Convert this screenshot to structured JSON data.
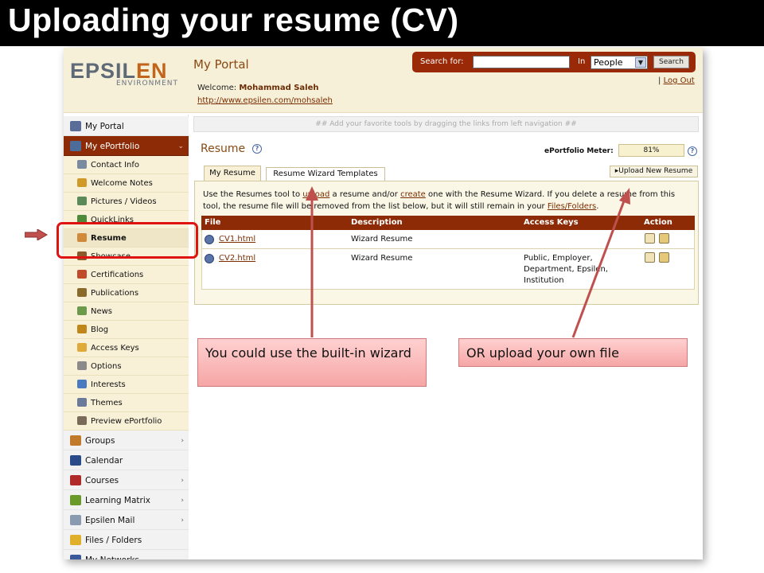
{
  "slide": {
    "title": "Uploading your resume (CV)"
  },
  "header": {
    "logo_main": "EPSIL",
    "logo_accent": "EN",
    "logo_sub": "ENVIRONMENT",
    "portal_title": "My Portal",
    "welcome_label": "Welcome:",
    "user_name": "Mohammad Saleh",
    "user_url": "http://www.epsilen.com/mohsaleh",
    "logout": "Log Out"
  },
  "search": {
    "label": "Search for:",
    "value": "",
    "in_label": "In",
    "scope": "People",
    "button": "Search"
  },
  "toolbar_hint": "## Add your favorite tools by dragging the links from left navigation ##",
  "sidebar": {
    "top_items": [
      {
        "label": "My Portal",
        "color": "#5a6d99"
      },
      {
        "label": "My ePortfolio",
        "color": "#4d6c9a"
      }
    ],
    "sub_items": [
      {
        "label": "Contact Info",
        "color": "#7a8aa0"
      },
      {
        "label": "Welcome Notes",
        "color": "#d09a2a"
      },
      {
        "label": "Pictures / Videos",
        "color": "#5a8a5a"
      },
      {
        "label": "QuickLinks",
        "color": "#4f8a3a"
      },
      {
        "label": "Resume",
        "color": "#d08a3a"
      },
      {
        "label": "Showcase",
        "color": "#8a5a2a"
      },
      {
        "label": "Certifications",
        "color": "#c04a2a"
      },
      {
        "label": "Publications",
        "color": "#8a6a2a"
      },
      {
        "label": "News",
        "color": "#6a9a4a"
      },
      {
        "label": "Blog",
        "color": "#c0861a"
      },
      {
        "label": "Access Keys",
        "color": "#e0aa3a"
      },
      {
        "label": "Options",
        "color": "#8a8a8a"
      },
      {
        "label": "Interests",
        "color": "#4a7ac0"
      },
      {
        "label": "Themes",
        "color": "#6a7a9a"
      },
      {
        "label": "Preview ePortfolio",
        "color": "#7a6a5a"
      }
    ],
    "bottom_items": [
      {
        "label": "Groups",
        "color": "#c07a2a"
      },
      {
        "label": "Calendar",
        "color": "#2a4a8a"
      },
      {
        "label": "Courses",
        "color": "#b02a2a"
      },
      {
        "label": "Learning Matrix",
        "color": "#6a9a2a"
      },
      {
        "label": "Epsilen Mail",
        "color": "#8a9ab0"
      },
      {
        "label": "Files / Folders",
        "color": "#e0b02a"
      },
      {
        "label": "My Networks",
        "color": "#3a5a9a"
      }
    ]
  },
  "content": {
    "heading": "Resume",
    "help_glyph": "?",
    "meter_label": "ePortfolio Meter:",
    "meter_value": "81%",
    "tabs": [
      "My Resume",
      "Resume Wizard Templates"
    ],
    "upload_button": "▸Upload New Resume",
    "intro": {
      "t1": "Use the Resumes tool to ",
      "upload_link": "upload",
      "t2": " a resume and/or ",
      "create_link": "create",
      "t3": " one with the Resume Wizard. If you delete a resume from this tool, the resume file will be removed from the list below, but it will still remain in your ",
      "files_link": "Files/Folders",
      "t4": "."
    },
    "table": {
      "headers": [
        "File",
        "Description",
        "Access Keys",
        "Action"
      ],
      "rows": [
        {
          "file": "CV1.html",
          "description": "Wizard Resume",
          "access_keys": ""
        },
        {
          "file": "CV2.html",
          "description": "Wizard Resume",
          "access_keys": "Public, Employer, Department, Epsilen, Institution"
        }
      ]
    }
  },
  "callouts": {
    "wizard": "You could use the built-in wizard",
    "upload": "OR upload your own file"
  },
  "colors": {
    "accent_red": "#8c2b06",
    "highlight": "#e01313",
    "callout": "#f6a6a6",
    "arrow": "#c0504d"
  }
}
